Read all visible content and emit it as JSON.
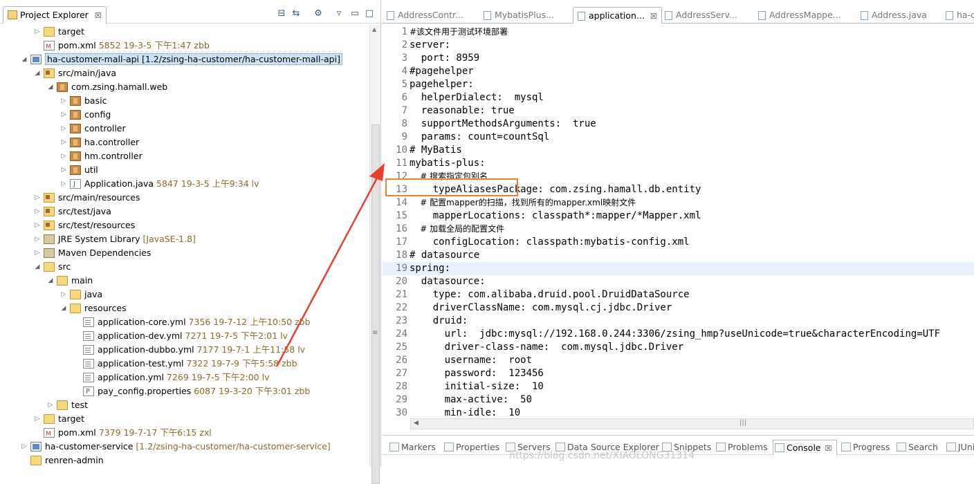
{
  "explorer": {
    "title": "Project Explorer",
    "close": "☒"
  },
  "tree": [
    {
      "lbl": "target",
      "dec": "",
      "icon": "folder",
      "d": 2,
      "tw": "▷"
    },
    {
      "lbl": "pom.xml",
      "dec": "5852  19-3-5 下午1:47  zbb",
      "icon": "xml",
      "d": 2,
      "tw": ""
    },
    {
      "lbl": "ha-customer-mall-api [1.2/zsing-ha-customer/ha-customer-mall-api]",
      "dec": "",
      "icon": "project",
      "d": 1,
      "tw": "◢",
      "sel": true
    },
    {
      "lbl": "src/main/java",
      "dec": "",
      "icon": "srcf",
      "d": 2,
      "tw": "◢"
    },
    {
      "lbl": "com.zsing.hamall.web",
      "dec": "",
      "icon": "pkg",
      "d": 3,
      "tw": "◢"
    },
    {
      "lbl": "basic",
      "dec": "",
      "icon": "pkg",
      "d": 4,
      "tw": "▷"
    },
    {
      "lbl": "config",
      "dec": "",
      "icon": "pkg",
      "d": 4,
      "tw": "▷"
    },
    {
      "lbl": "controller",
      "dec": "",
      "icon": "pkg",
      "d": 4,
      "tw": "▷"
    },
    {
      "lbl": "ha.controller",
      "dec": "",
      "icon": "pkg",
      "d": 4,
      "tw": "▷"
    },
    {
      "lbl": "hm.controller",
      "dec": "",
      "icon": "pkg",
      "d": 4,
      "tw": "▷"
    },
    {
      "lbl": "util",
      "dec": "",
      "icon": "pkg",
      "d": 4,
      "tw": "▷"
    },
    {
      "lbl": "Application.java",
      "dec": "5847  19-3-5 上午9:34  lv",
      "icon": "java",
      "d": 4,
      "tw": "▷"
    },
    {
      "lbl": "src/main/resources",
      "dec": "",
      "icon": "srcf",
      "d": 2,
      "tw": "▷"
    },
    {
      "lbl": "src/test/java",
      "dec": "",
      "icon": "srcf",
      "d": 2,
      "tw": "▷"
    },
    {
      "lbl": "src/test/resources",
      "dec": "",
      "icon": "srcf",
      "d": 2,
      "tw": "▷"
    },
    {
      "lbl": "JRE System Library",
      "dec": "[JavaSE-1.8]",
      "icon": "lib",
      "d": 2,
      "tw": "▷"
    },
    {
      "lbl": "Maven Dependencies",
      "dec": "",
      "icon": "lib",
      "d": 2,
      "tw": "▷"
    },
    {
      "lbl": "src",
      "dec": "",
      "icon": "folder",
      "d": 2,
      "tw": "◢"
    },
    {
      "lbl": "main",
      "dec": "",
      "icon": "folder",
      "d": 3,
      "tw": "◢"
    },
    {
      "lbl": "java",
      "dec": "",
      "icon": "folder",
      "d": 4,
      "tw": "▷"
    },
    {
      "lbl": "resources",
      "dec": "",
      "icon": "folder",
      "d": 4,
      "tw": "◢"
    },
    {
      "lbl": "application-core.yml",
      "dec": "7356  19-7-12 上午10:50  zbb",
      "icon": "yml",
      "d": 5,
      "tw": ""
    },
    {
      "lbl": "application-dev.yml",
      "dec": "7271  19-7-5 下午2:01  lv",
      "icon": "yml",
      "d": 5,
      "tw": ""
    },
    {
      "lbl": "application-dubbo.yml",
      "dec": "7177  19-7-1 上午11:58  lv",
      "icon": "yml",
      "d": 5,
      "tw": ""
    },
    {
      "lbl": "application-test.yml",
      "dec": "7322  19-7-9 下午5:58  zbb",
      "icon": "yml",
      "d": 5,
      "tw": ""
    },
    {
      "lbl": "application.yml",
      "dec": "7269  19-7-5 下午2:00  lv",
      "icon": "yml",
      "d": 5,
      "tw": ""
    },
    {
      "lbl": "pay_config.properties",
      "dec": "6087  19-3-20 下午3:01  zbb",
      "icon": "props",
      "d": 5,
      "tw": ""
    },
    {
      "lbl": "test",
      "dec": "",
      "icon": "folder",
      "d": 3,
      "tw": "▷"
    },
    {
      "lbl": "target",
      "dec": "",
      "icon": "folder",
      "d": 2,
      "tw": "▷"
    },
    {
      "lbl": "pom.xml",
      "dec": "7379  19-7-17 下午6:15  zxl",
      "icon": "xml",
      "d": 2,
      "tw": ""
    },
    {
      "lbl": "ha-customer-service",
      "dec": "[1.2/zsing-ha-customer/ha-customer-service]",
      "icon": "project",
      "d": 1,
      "tw": "▷"
    },
    {
      "lbl": "renren-admin",
      "dec": "",
      "icon": "folder",
      "d": 1,
      "tw": ""
    }
  ],
  "editor_tabs": [
    {
      "label": "AddressContr...",
      "active": false
    },
    {
      "label": "MybatisPlus...",
      "active": false
    },
    {
      "label": "application...",
      "active": true
    },
    {
      "label": "AddressServ...",
      "active": false
    },
    {
      "label": "AddressMappe...",
      "active": false
    },
    {
      "label": "Address.java",
      "active": false
    },
    {
      "label": "ha-c",
      "active": false
    }
  ],
  "code": [
    {
      "n": "1",
      "t": "#该文件用于测试环境部署",
      "cm": true
    },
    {
      "n": "2",
      "t": "server:"
    },
    {
      "n": "3",
      "t": "  port: 8959"
    },
    {
      "n": "4",
      "t": "#pagehelper"
    },
    {
      "n": "5",
      "t": "pagehelper:"
    },
    {
      "n": "6",
      "t": "  helperDialect:  mysql"
    },
    {
      "n": "7",
      "t": "  reasonable: true"
    },
    {
      "n": "8",
      "t": "  supportMethodsArguments:  true"
    },
    {
      "n": "9",
      "t": "  params: count=countSql"
    },
    {
      "n": "10",
      "t": "# MyBatis"
    },
    {
      "n": "11",
      "t": "mybatis-plus:"
    },
    {
      "n": "12",
      "t": "    # 搜索指定包别名",
      "cm": true
    },
    {
      "n": "13",
      "t": "    typeAliasesPackage: com.zsing.hamall.db.entity"
    },
    {
      "n": "14",
      "t": "    # 配置mapper的扫描，找到所有的mapper.xml映射文件",
      "cm": true
    },
    {
      "n": "15",
      "t": "    mapperLocations: classpath*:mapper/*Mapper.xml"
    },
    {
      "n": "16",
      "t": "    # 加载全局的配置文件",
      "cm": true
    },
    {
      "n": "17",
      "t": "    configLocation: classpath:mybatis-config.xml"
    },
    {
      "n": "18",
      "t": "# datasource"
    },
    {
      "n": "19",
      "t": "spring:",
      "cur": true
    },
    {
      "n": "20",
      "t": "  datasource:"
    },
    {
      "n": "21",
      "t": "    type: com.alibaba.druid.pool.DruidDataSource"
    },
    {
      "n": "22",
      "t": "    driverClassName: com.mysql.cj.jdbc.Driver"
    },
    {
      "n": "23",
      "t": "    druid:"
    },
    {
      "n": "24",
      "t": "      url:  jdbc:mysql://192.168.0.244:3306/zsing_hmp?useUnicode=true&characterEncoding=UTF"
    },
    {
      "n": "25",
      "t": "      driver-class-name:  com.mysql.jdbc.Driver"
    },
    {
      "n": "26",
      "t": "      username:  root"
    },
    {
      "n": "27",
      "t": "      password:  123456"
    },
    {
      "n": "28",
      "t": "      initial-size:  10"
    },
    {
      "n": "29",
      "t": "      max-active:  50"
    },
    {
      "n": "30",
      "t": "      min-idle:  10"
    }
  ],
  "bottom_tabs": [
    {
      "label": "Markers",
      "active": false
    },
    {
      "label": "Properties",
      "active": false
    },
    {
      "label": "Servers",
      "active": false
    },
    {
      "label": "Data Source Explorer",
      "active": false
    },
    {
      "label": "Snippets",
      "active": false
    },
    {
      "label": "Problems",
      "active": false
    },
    {
      "label": "Console",
      "active": true
    },
    {
      "label": "Progress",
      "active": false
    },
    {
      "label": "Search",
      "active": false
    },
    {
      "label": "JUnit",
      "active": false
    }
  ],
  "watermark": "https://blog.csdn.net/XIAOLONG31314",
  "colors": {
    "highlight_box": "#f0822c",
    "arrow": "#e8402c"
  }
}
